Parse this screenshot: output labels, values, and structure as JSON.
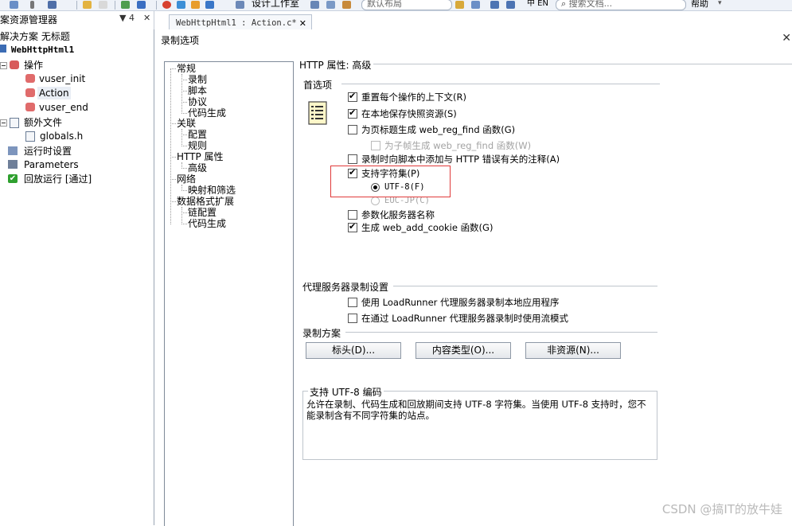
{
  "toolbar": {
    "design_workspace": "设计工作室",
    "layout_combo": "默认布局",
    "lang_btn": "中 EN",
    "search_placeholder": "搜索文档...",
    "help_menu": "帮助"
  },
  "explorer": {
    "title": "案资源管理器",
    "pin": "▼ 4",
    "close": "✕",
    "solution_label": "解决方案 无标题",
    "project": "WebHttpHtml1",
    "actions_folder": "操作",
    "actions": [
      "vuser_init",
      "Action",
      "vuser_end"
    ],
    "extra_files_folder": "额外文件",
    "extra_files": [
      "globals.h"
    ],
    "runtime_settings": "运行时设置",
    "parameters": "Parameters",
    "replay": "回放运行 [通过]"
  },
  "doc_tab": {
    "label": "WebHttpHtml1 : Action.c*",
    "close": "✕"
  },
  "dialog": {
    "title": "录制选项",
    "close": "✕",
    "nav": {
      "general": "常规",
      "general_children": [
        "录制",
        "脚本",
        "协议",
        "代码生成"
      ],
      "correlation": "关联",
      "correlation_children": [
        "配置",
        "规则"
      ],
      "http": "HTTP 属性",
      "http_children": [
        "高级"
      ],
      "network": "网络",
      "network_children": [
        "映射和筛选"
      ],
      "data_format": "数据格式扩展",
      "data_format_children": [
        "链配置",
        "代码生成"
      ]
    },
    "panel_title": "HTTP 属性: 高级",
    "prefs_section": "首选项",
    "options": {
      "reset_context": "重置每个操作的上下文(R)",
      "save_snapshot": "在本地保存快照资源(S)",
      "web_reg_find": "为页标题生成 web_reg_find 函数(G)",
      "web_reg_find_child": "为子帧生成 web_reg_find 函数(W)",
      "add_comments": "录制时向脚本中添加与 HTTP 错误有关的注释(A)",
      "charset_support": "支持字符集(P)",
      "utf8": "UTF-8(F)",
      "eucjp": "EUC-JP(C)",
      "param_server": "参数化服务器名称",
      "add_cookie": "生成 web_add_cookie 函数(G)"
    },
    "proxy_section": "代理服务器录制设置",
    "proxy_options": {
      "use_lr_proxy": "使用 LoadRunner 代理服务器录制本地应用程序",
      "streaming": "在通过 LoadRunner 代理服务器录制时使用流模式"
    },
    "schemes_section": "录制方案",
    "buttons": {
      "headers": "标头(D)...",
      "content_types": "内容类型(O)...",
      "non_resources": "非资源(N)..."
    },
    "description": {
      "title": "支持 UTF-8 编码",
      "text": "允许在录制、代码生成和回放期间支持 UTF-8 字符集。当使用 UTF-8 支持时，您不能录制含有不同字符集的站点。"
    }
  },
  "watermark": "CSDN @搞IT的放牛娃",
  "colors": {
    "highlight_border": "#e03a3a",
    "toolbar_bg": "#eef2f8",
    "check_green": "#2fa02f"
  }
}
